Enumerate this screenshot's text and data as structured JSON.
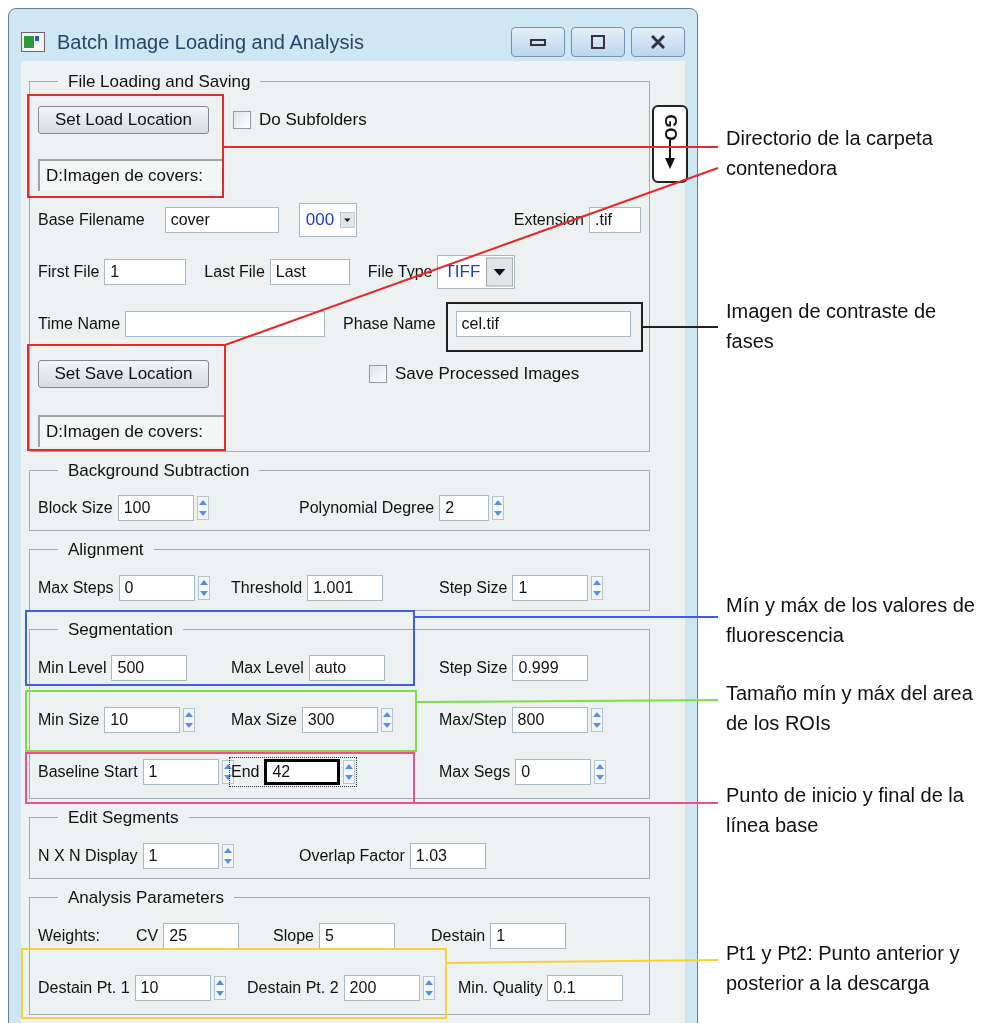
{
  "window": {
    "title": "Batch Image Loading and Analysis"
  },
  "file_loading": {
    "title": "File Loading and Saving",
    "load_button": "Set Load Location",
    "do_subfolders": {
      "label": "Do Subfolders",
      "checked": false
    },
    "load_path": "D:Imagen de covers:",
    "base_filename": {
      "label": "Base Filename",
      "value": "cover"
    },
    "number_format": "000",
    "extension": {
      "label": "Extension",
      "value": ".tif"
    },
    "first_file": {
      "label": "First File",
      "value": "1"
    },
    "last_file": {
      "label": "Last File",
      "value": "Last"
    },
    "file_type": {
      "label": "File Type",
      "value": "TIFF"
    },
    "time_name": {
      "label": "Time Name"
    },
    "phase_name": {
      "label": "Phase Name",
      "value": "cel.tif"
    },
    "save_button": "Set Save Location",
    "save_processed": {
      "label": "Save Processed Images",
      "checked": false
    },
    "save_path": "D:Imagen de covers:"
  },
  "go_button": "GO",
  "groups": [
    {
      "title": "Background Subtraction",
      "rows": [
        {
          "fields": [
            {
              "label": "Block Size",
              "value": "100",
              "spinner": true,
              "focused": false
            },
            {
              "label": "Polynomial Degree",
              "value": "2",
              "spinner": true,
              "focused": false
            }
          ]
        }
      ]
    },
    {
      "title": "Alignment",
      "rows": [
        {
          "fields": [
            {
              "label": "Max Steps",
              "value": "0",
              "spinner": true,
              "focused": false
            },
            {
              "label": "Threshold",
              "value": "1.001",
              "spinner": false,
              "focused": false
            },
            {
              "label": "Step Size",
              "value": "1",
              "spinner": true,
              "focused": false
            }
          ]
        }
      ]
    },
    {
      "title": "Segmentation",
      "rows": [
        {
          "fields": [
            {
              "label": "Min Level",
              "value": "500",
              "spinner": false,
              "focused": false
            },
            {
              "label": "Max Level",
              "value": "auto",
              "spinner": false,
              "focused": false
            },
            {
              "label": "Step Size",
              "value": "0.999",
              "spinner": false,
              "focused": false
            }
          ]
        },
        {
          "fields": [
            {
              "label": "Min Size",
              "value": "10",
              "spinner": true,
              "focused": false
            },
            {
              "label": "Max Size",
              "value": "300",
              "spinner": true,
              "focused": false
            },
            {
              "label": "Max/Step",
              "value": "800",
              "spinner": true,
              "focused": false
            }
          ]
        },
        {
          "fields": [
            {
              "label": "Baseline Start",
              "value": "1",
              "spinner": true,
              "focused": false
            },
            {
              "label": "End",
              "value": "42",
              "spinner": true,
              "focused": true
            },
            {
              "label": "Max Segs",
              "value": "0",
              "spinner": true,
              "focused": false
            }
          ]
        }
      ]
    },
    {
      "title": "Edit Segments",
      "rows": [
        {
          "fields": [
            {
              "label": "N X N Display",
              "value": "1",
              "spinner": true,
              "focused": false
            },
            {
              "label": "Overlap Factor",
              "value": "1.03",
              "spinner": false,
              "focused": false
            }
          ]
        }
      ]
    },
    {
      "title": "Analysis Parameters",
      "rows": [
        {
          "lead": "Weights:",
          "fields": [
            {
              "label": "CV",
              "value": "25",
              "spinner": false,
              "focused": false
            },
            {
              "label": "Slope",
              "value": "5",
              "spinner": false,
              "focused": false
            },
            {
              "label": "Destain",
              "value": "1",
              "spinner": false,
              "focused": false
            }
          ]
        },
        {
          "fields": [
            {
              "label": "Destain Pt. 1",
              "value": "10",
              "spinner": true,
              "focused": false
            },
            {
              "label": "Destain Pt. 2",
              "value": "200",
              "spinner": true,
              "focused": false
            },
            {
              "label": "Min. Quality",
              "value": "0.1",
              "spinner": false,
              "focused": false
            }
          ]
        }
      ]
    }
  ],
  "annotations": [
    {
      "text": "Directorio de la carpeta contenedora",
      "color": "#e52a2a"
    },
    {
      "text": "Imagen de contraste de fases",
      "color": "#222222"
    },
    {
      "text": "Mín y máx de los valores de fluorescencia",
      "color": "#3a5ff0"
    },
    {
      "text": "Tamaño mín y máx del area de los ROIs",
      "color": "#7ee040"
    },
    {
      "text": "Punto de inicio y final de la línea base",
      "color": "#f0508a"
    },
    {
      "text": "Pt1 y Pt2: Punto anterior y posterior a la descarga",
      "color": "#f5d23a"
    }
  ]
}
